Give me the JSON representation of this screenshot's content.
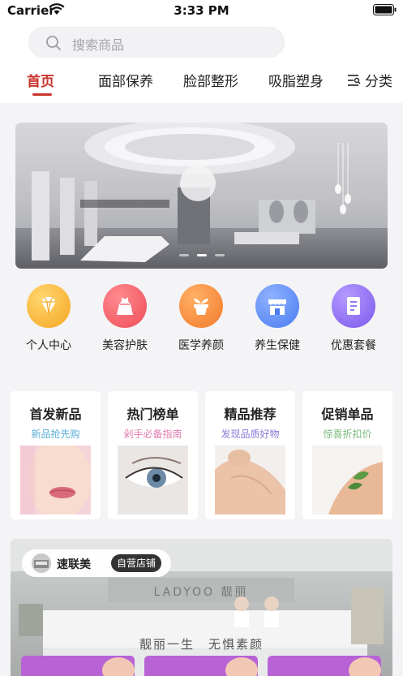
{
  "status_bar": {
    "carrier": "Carrier",
    "time": "3:33 PM"
  },
  "search": {
    "placeholder": "搜索商品"
  },
  "nav": {
    "tabs": [
      {
        "label": "首页",
        "active": true
      },
      {
        "label": "面部保养",
        "active": false
      },
      {
        "label": "脸部整形",
        "active": false
      },
      {
        "label": "吸脂塑身",
        "active": false
      }
    ],
    "category_label": "分类",
    "accent_color": "#c9342d"
  },
  "banner": {
    "slide_count": 3,
    "active_slide": 1,
    "sign_text": "LADYOO 靓丽"
  },
  "shortcuts": [
    {
      "label": "个人中心",
      "icon": "diamond-icon",
      "color": "#f7b733"
    },
    {
      "label": "美容护肤",
      "icon": "dress-icon",
      "color": "#f2606a"
    },
    {
      "label": "医学养颜",
      "icon": "sprout-pot-icon",
      "color": "#f5913b"
    },
    {
      "label": "养生保健",
      "icon": "shop-icon",
      "color": "#5b8df6"
    },
    {
      "label": "优惠套餐",
      "icon": "document-icon",
      "color": "#8b6cf2"
    }
  ],
  "promos": [
    {
      "title": "首发新品",
      "subtitle": "新品抢先购",
      "sub_color": "#5aaed8"
    },
    {
      "title": "热门榜单",
      "subtitle": "剁手必备指南",
      "sub_color": "#e07bb0"
    },
    {
      "title": "精品推荐",
      "subtitle": "发现品质好物",
      "sub_color": "#8a78d6"
    },
    {
      "title": "促销单品",
      "subtitle": "惊喜折扣价",
      "sub_color": "#7ab87a"
    }
  ],
  "store": {
    "name": "速联美",
    "tag": "自营店铺",
    "logo_text": "LADYOO 靓丽",
    "sign_text": "靓丽一生　无惧素颜"
  }
}
